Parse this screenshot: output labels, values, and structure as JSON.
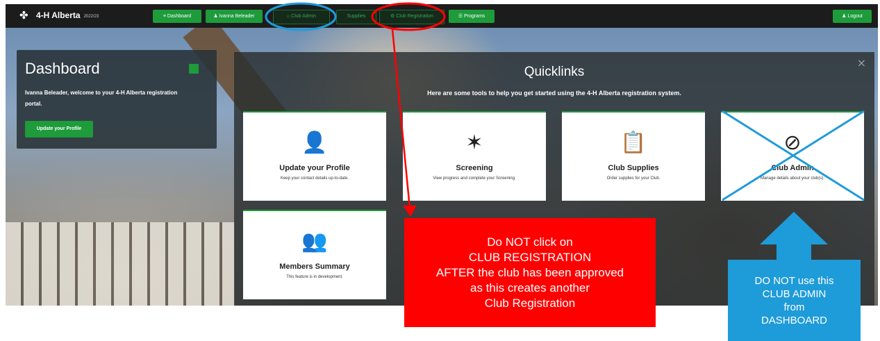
{
  "header": {
    "logo_icon": "clover-icon",
    "brand": "4-H Alberta",
    "year": "2022/23",
    "nav": [
      {
        "label": "≡ Dashboard",
        "style": "green"
      },
      {
        "label": "♟ Ivanna Beleader",
        "style": "green"
      },
      {
        "label": "⌂ Club Admin",
        "style": "dark"
      },
      {
        "label": "Supplies",
        "style": "dark"
      },
      {
        "label": "⚙ Club Registration",
        "style": "dark"
      },
      {
        "label": "☰ Programs",
        "style": "green"
      }
    ],
    "logout": "♟ Logout"
  },
  "dashboard": {
    "title": "Dashboard",
    "welcome": "Ivanna Beleader, welcome to your 4-H Alberta registration portal.",
    "update_button": "Update your Profile"
  },
  "quicklinks": {
    "close": "×",
    "title": "Quicklinks",
    "subtitle": "Here are some tools to help you get started using the 4-H Alberta registration system.",
    "cards": [
      {
        "title": "Update your Profile",
        "desc": "Keep your contact details up-to-date.",
        "icon": "person-icon",
        "glyph": "👤"
      },
      {
        "title": "Screening",
        "desc": "View progress and complete your Screening.",
        "icon": "star-icon",
        "glyph": "✶"
      },
      {
        "title": "Club Supplies",
        "desc": "Order supplies for your Club.",
        "icon": "clipboard-icon",
        "glyph": "📋"
      },
      {
        "title": "Club Admin",
        "desc": "Manage details about your club(s).",
        "icon": "compass-icon",
        "glyph": "⊘"
      },
      {
        "title": "Members Summary",
        "desc": "This feature is in development.",
        "icon": "group-icon",
        "glyph": "👥"
      }
    ]
  },
  "annotations": {
    "red_box": "Do NOT click on\nCLUB REGISTRATION\nAFTER the club has been approved\nas this creates another\nClub Registration",
    "blue_box": "DO NOT use this\nCLUB ADMIN\nfrom\nDASHBOARD",
    "colors": {
      "red": "#ff0000",
      "blue": "#1e9bd9",
      "green": "#1e9b3b"
    }
  }
}
